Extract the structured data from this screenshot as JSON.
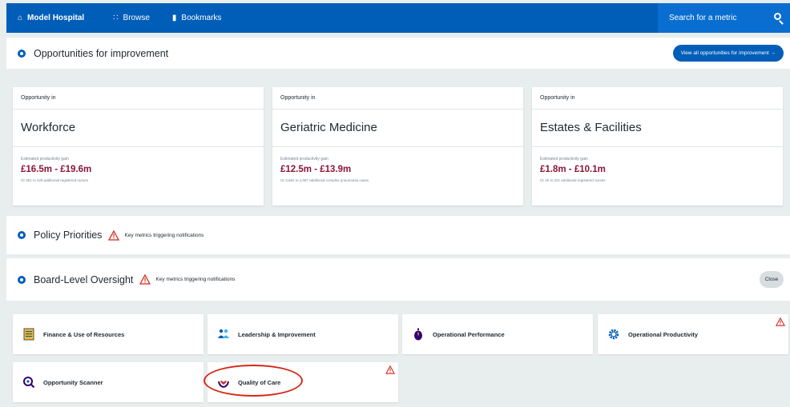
{
  "nav": {
    "brand": "Model Hospital",
    "browse": "Browse",
    "bookmarks": "Bookmarks",
    "search_placeholder": "Search for a metric"
  },
  "opportunities": {
    "title": "Opportunities for improvement",
    "view_all_button": "View all opportunities for improvement →",
    "cards": [
      {
        "label": "Opportunity in",
        "area": "Workforce",
        "gain_label": "Estimated productivity gain",
        "gain_value": "£16.5m - £19.6m",
        "gain_note": "Or 361 to 429 additional registered nurses"
      },
      {
        "label": "Opportunity in",
        "area": "Geriatric Medicine",
        "gain_label": "Estimated productivity gain",
        "gain_value": "£12.5m - £13.9m",
        "gain_note": "Or 3,661 to 4,087 additional complex pneumonia cases"
      },
      {
        "label": "Opportunity in",
        "area": "Estates & Facilities",
        "gain_label": "Estimated productivity gain",
        "gain_value": "£1.8m - £10.1m",
        "gain_note": "Or 40 to 221 additional registered nurses"
      }
    ]
  },
  "policy": {
    "title": "Policy Priorities",
    "warning": "Key metrics triggering notifications"
  },
  "board": {
    "title": "Board-Level Oversight",
    "warning": "Key metrics triggering notifications",
    "close_button": "Close",
    "tiles": [
      {
        "label": "Finance & Use of Resources",
        "icon": "ledger-icon",
        "warn": false
      },
      {
        "label": "Leadership & Improvement",
        "icon": "people-icon",
        "warn": false
      },
      {
        "label": "Operational Performance",
        "icon": "stopwatch-icon",
        "warn": false
      },
      {
        "label": "Operational Productivity",
        "icon": "gear-icon",
        "warn": true
      },
      {
        "label": "Opportunity Scanner",
        "icon": "magnifier-icon",
        "warn": false
      },
      {
        "label": "Quality of Care",
        "icon": "heart-hands-icon",
        "warn": true
      }
    ]
  },
  "colors": {
    "nhs_blue": "#005eb8",
    "gain_text": "#8a1538",
    "warning_red": "#d5281b",
    "background": "#e8edee"
  }
}
